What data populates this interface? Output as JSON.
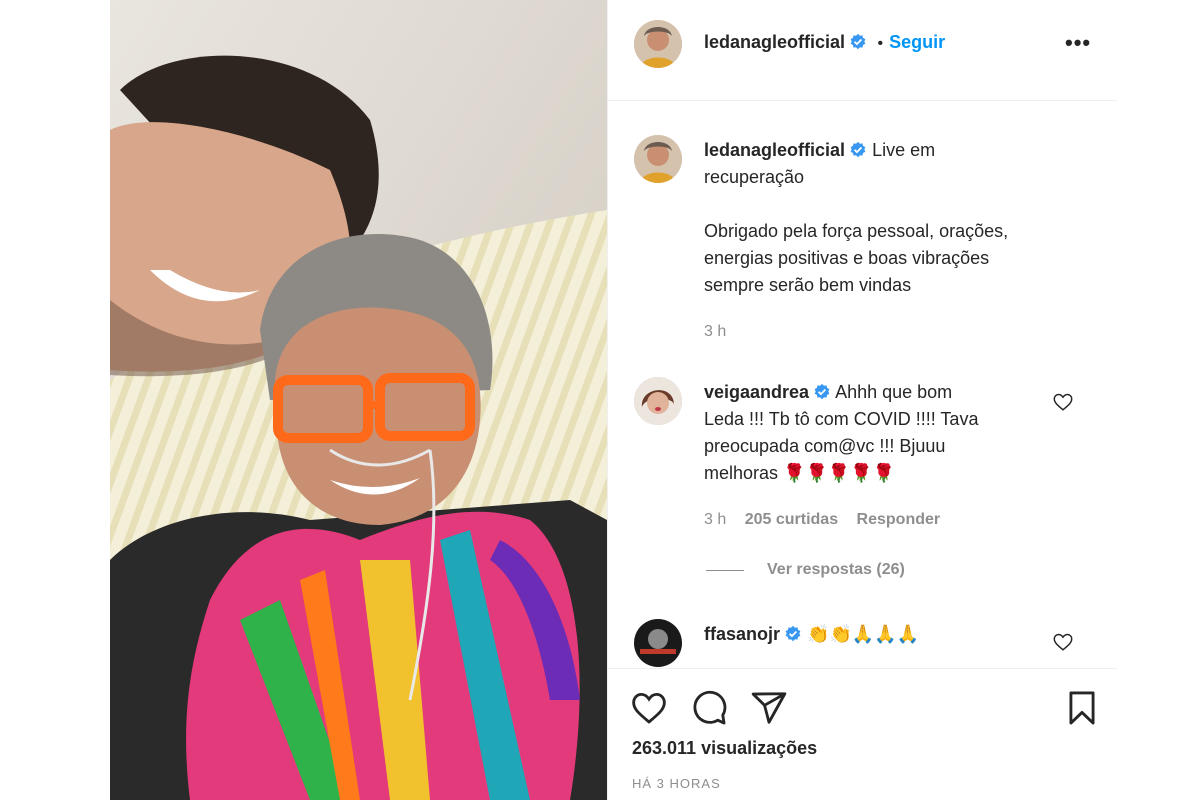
{
  "post": {
    "username": "ledanagleofficial",
    "follow_label": "Seguir",
    "more_label": "•••",
    "separator": "•"
  },
  "caption": {
    "username": "ledanagleofficial",
    "line1": "Live em",
    "line2": "recuperação",
    "body_lines": [
      "Obrigado pela força pessoal, orações,",
      "energias positivas e boas vibrações",
      "sempre serão bem vindas"
    ],
    "time": "3 h"
  },
  "comments": [
    {
      "username": "veigaandrea",
      "lines": [
        "Ahhh que bom",
        "Leda !!! Tb tô com COVID !!!! Tava",
        "preocupada com@vc !!! Bjuuu",
        "melhoras 🌹🌹🌹🌹🌹"
      ],
      "time": "3 h",
      "likes": "205 curtidas",
      "reply_label": "Responder",
      "view_replies": "Ver respostas (26)"
    },
    {
      "username": "ffasanojr",
      "text": "👏👏🙏🙏🙏"
    }
  ],
  "footer": {
    "views": "263.011 visualizações",
    "posted": "HÁ 3 HORAS"
  },
  "colors": {
    "accent": "#0095f6",
    "verified": "#3897f0",
    "muted": "#8e8e8e",
    "border": "#efefef"
  },
  "icons": [
    "heart-icon",
    "comment-icon",
    "share-icon",
    "bookmark-icon",
    "verified-badge-icon",
    "more-options-icon"
  ]
}
